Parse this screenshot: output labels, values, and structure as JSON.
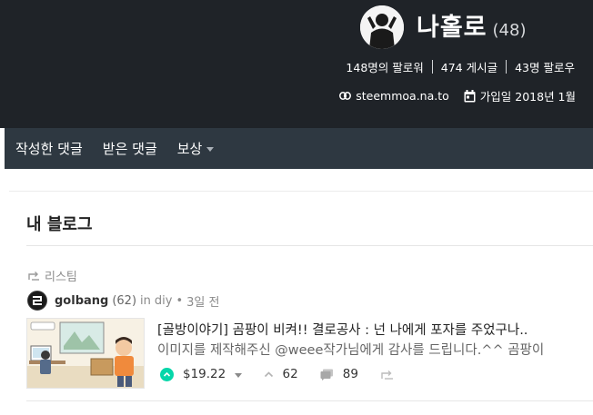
{
  "profile": {
    "name": "나홀로",
    "reputation": "(48)",
    "stats": {
      "followers": "148명의 팔로워",
      "posts": "474 게시글",
      "following": "43명 팔로우"
    },
    "website": "steemmoa.na.to",
    "joined": "가입일 2018년 1월"
  },
  "nav": {
    "items": [
      "작성한 댓글",
      "받은 댓글",
      "보상"
    ],
    "dropdown_item": "보상"
  },
  "blog": {
    "title": "내 블로그",
    "resteem_label": "리스팀",
    "post": {
      "author": "golbang",
      "author_rep": "(62)",
      "in_label": "in",
      "category": "diy",
      "separator": "•",
      "time": "3일 전",
      "title": "[골방이야기] 곰팡이 비켜!! 결로공사 : 넌 나에게 포자를 주었구나..",
      "body": "이미지를 제작해주신 @weee작가님에게 감사를 드립니다.^^ 곰팡이",
      "payout": "$19.22",
      "votes": "62",
      "comments": "89"
    }
  },
  "colors": {
    "header_bg": "#1f2328",
    "nav_bg": "#2e3841",
    "upvote_accent": "#06d6a9"
  },
  "icons": {
    "avatar": "profile-avatar",
    "website": "link-icon",
    "joined": "calendar-icon",
    "resteem": "resteem-icon",
    "author_avatar": "golbang-logo",
    "upvote": "upvote-icon",
    "votes": "chevron-up-icon",
    "comments": "comments-icon",
    "share": "resteem-icon"
  }
}
